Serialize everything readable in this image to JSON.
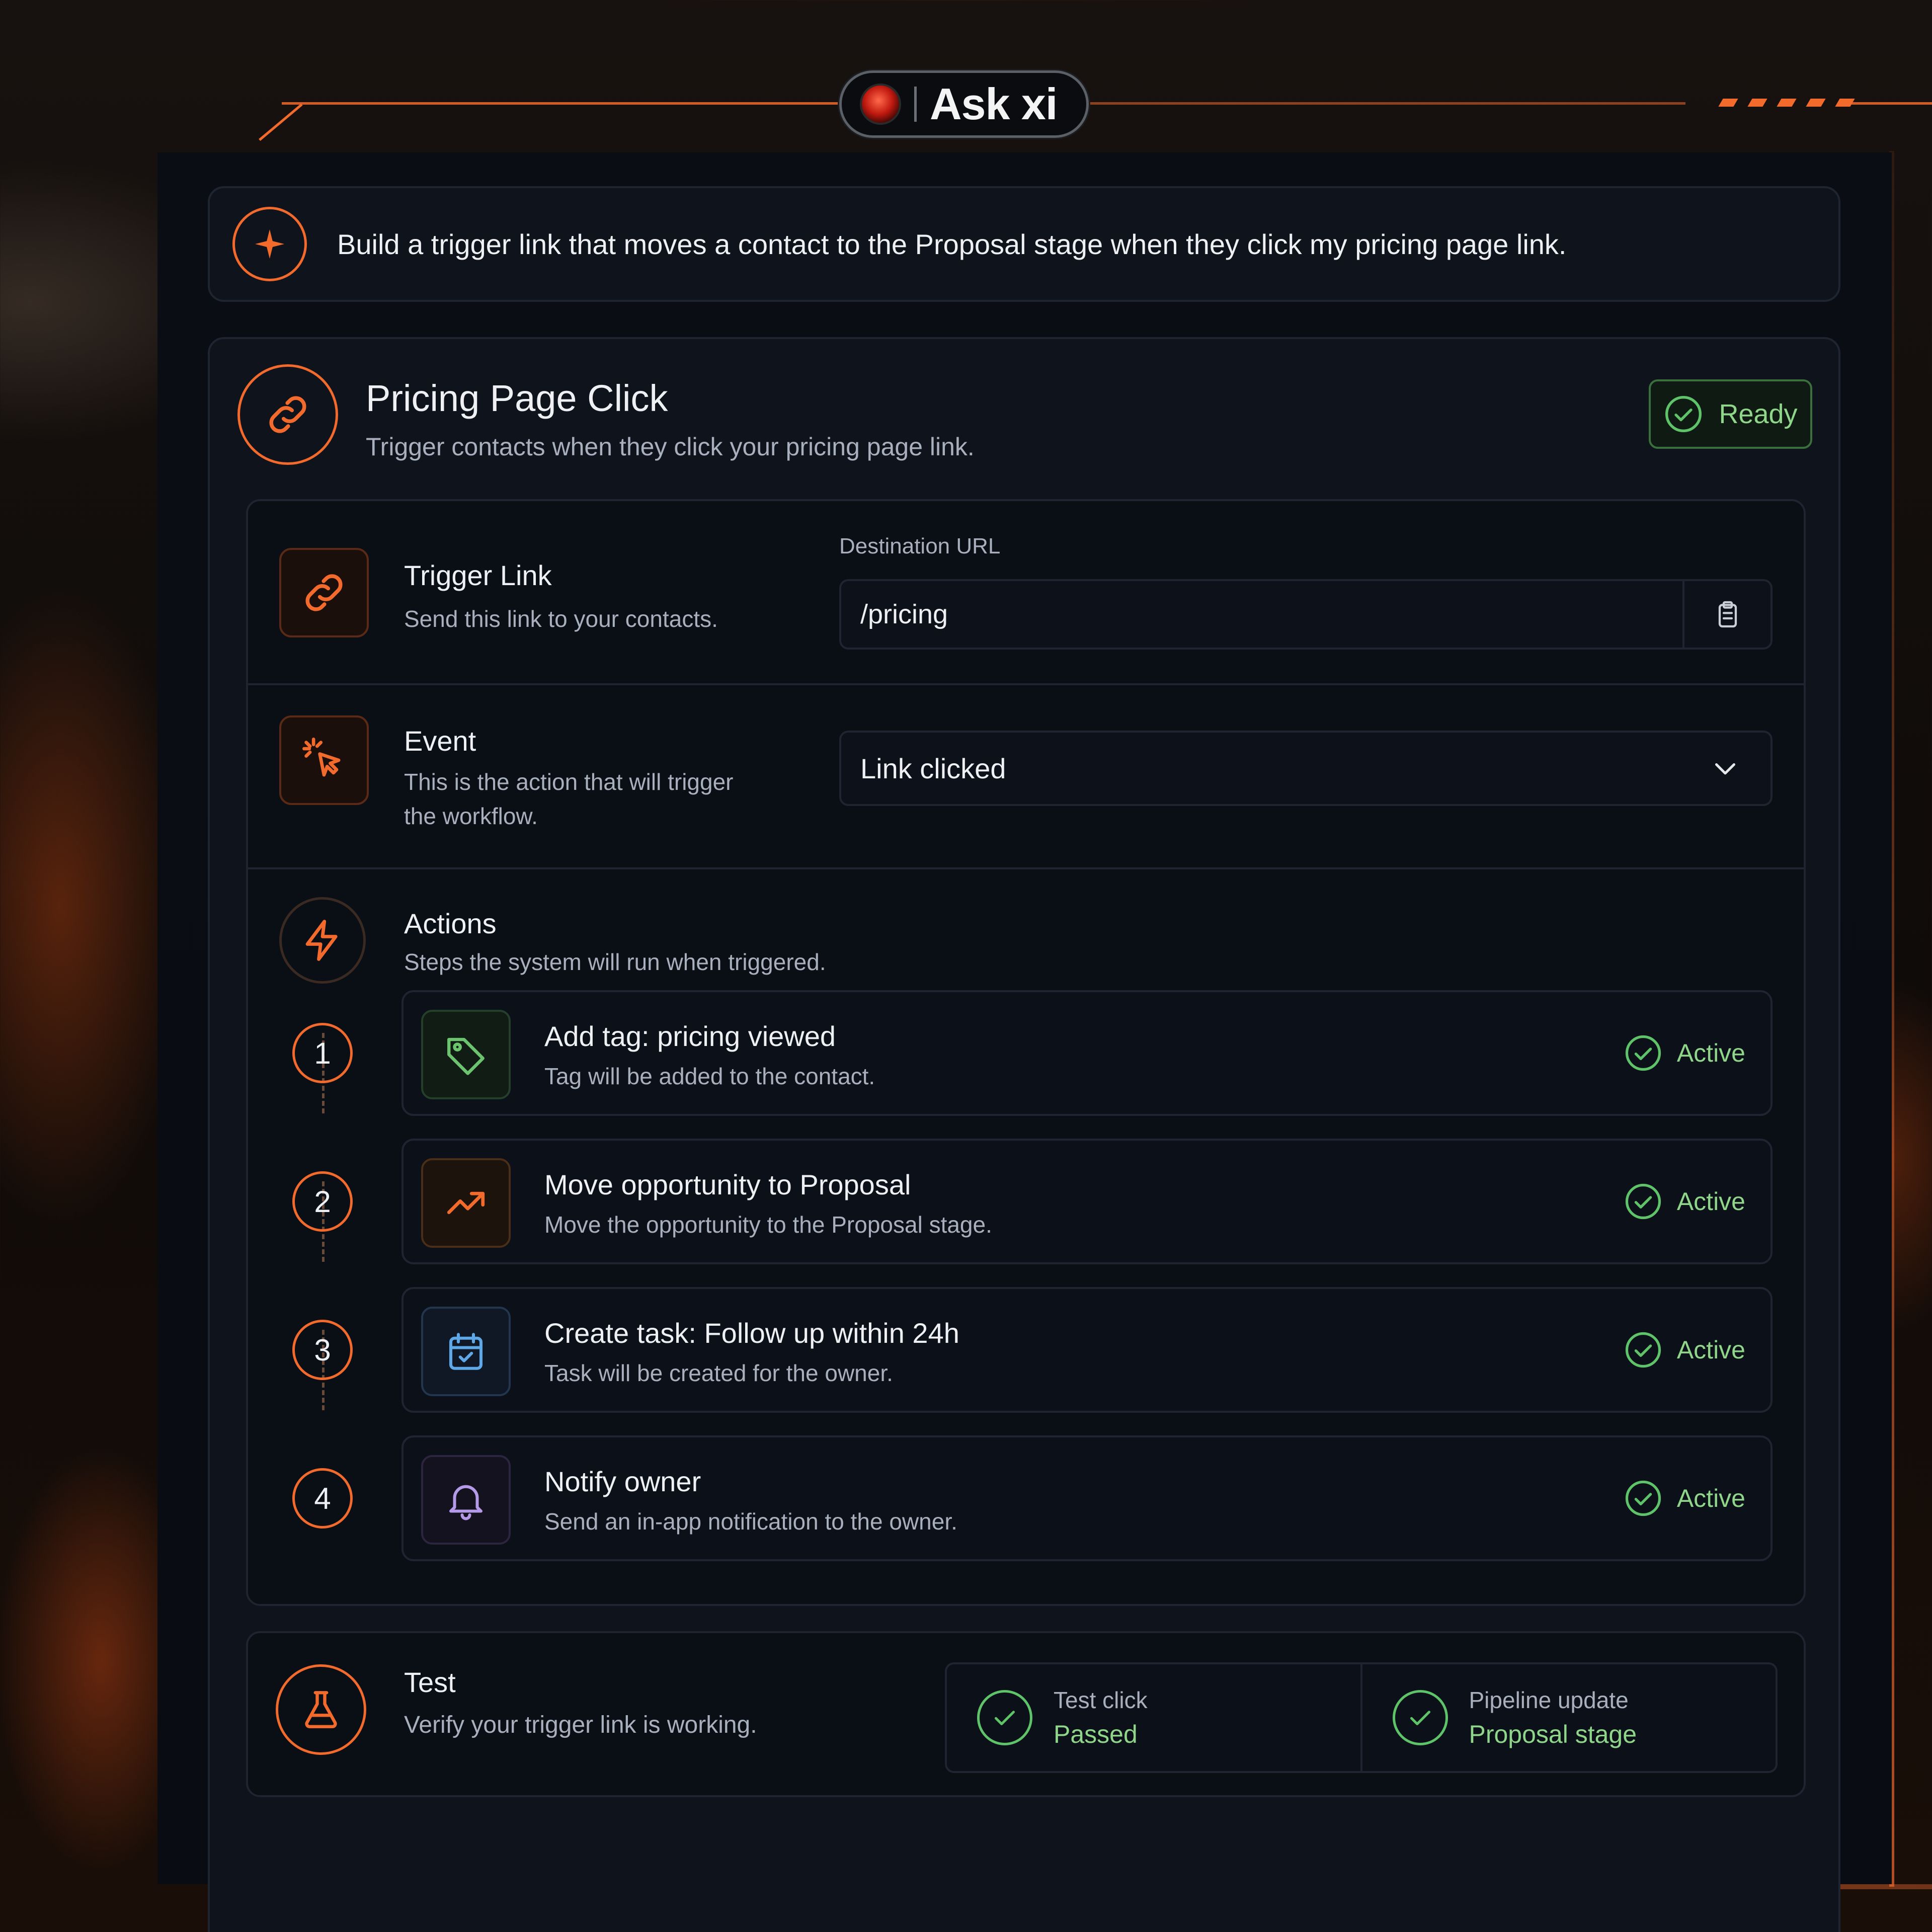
{
  "app": {
    "name": "Ask xi",
    "accent_color": "#f26a2c",
    "success_color": "#5fc36a"
  },
  "prompt": {
    "icon": "sparkle-icon",
    "text": "Build a trigger link that moves a contact to the Proposal stage when they click my pricing page link."
  },
  "workflow": {
    "icon": "link-icon",
    "title": "Pricing Page Click",
    "subtitle": "Trigger contacts when they click your pricing page link.",
    "status": "Ready"
  },
  "trigger_link": {
    "icon": "link-icon",
    "title": "Trigger Link",
    "subtitle": "Send this link to your contacts.",
    "field_label": "Destination URL",
    "value": "/pricing",
    "copy_icon": "clipboard-icon"
  },
  "event": {
    "icon": "cursor-click-icon",
    "title": "Event",
    "subtitle_line1": "This is the action that will trigger",
    "subtitle_line2": "the workflow.",
    "selected": "Link clicked",
    "dropdown_icon": "chevron-down-icon"
  },
  "actions": {
    "icon": "lightning-icon",
    "title": "Actions",
    "subtitle": "Steps the system will run when triggered.",
    "items": [
      {
        "step": "1",
        "icon": "tag-icon",
        "title": "Add tag: pricing viewed",
        "subtitle": "Tag will be added to the contact.",
        "status": "Active"
      },
      {
        "step": "2",
        "icon": "trending-up-icon",
        "title": "Move opportunity to Proposal",
        "subtitle": "Move the opportunity to the Proposal stage.",
        "status": "Active"
      },
      {
        "step": "3",
        "icon": "calendar-check-icon",
        "title": "Create task: Follow up within 24h",
        "subtitle": "Task will be created for the owner.",
        "status": "Active"
      },
      {
        "step": "4",
        "icon": "bell-icon",
        "title": "Notify owner",
        "subtitle": "Send an in-app notification to the owner.",
        "status": "Active"
      }
    ]
  },
  "test": {
    "icon": "flask-icon",
    "title": "Test",
    "subtitle": "Verify your trigger link is working.",
    "results": [
      {
        "label": "Test click",
        "value": "Passed"
      },
      {
        "label": "Pipeline update",
        "value": "Proposal stage"
      }
    ]
  }
}
